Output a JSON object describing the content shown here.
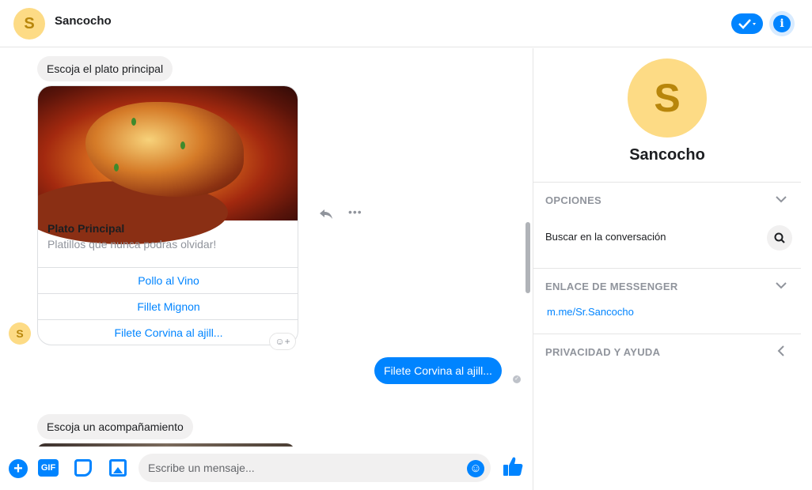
{
  "header": {
    "avatar_letter": "S",
    "title": "Sancocho"
  },
  "chat": {
    "prompt1": "Escoja el plato principal",
    "card": {
      "title": "Plato Principal",
      "subtitle": "Platillos que nunca podras olvidar!",
      "buttons": [
        "Pollo al Vino",
        "Fillet Mignon",
        "Filete Corvina al ajill..."
      ]
    },
    "sender_avatar_letter": "S",
    "outgoing": "Filete Corvina al ajill...",
    "prompt2": "Escoja un acompañamiento"
  },
  "composer": {
    "gif_label": "GIF",
    "placeholder": "Escribe un mensaje..."
  },
  "sidebar": {
    "avatar_letter": "S",
    "name": "Sancocho",
    "options_header": "OPCIONES",
    "search_label": "Buscar en la conversación",
    "link_header": "ENLACE DE MESSENGER",
    "link": "m.me/Sr.Sancocho",
    "privacy_header": "PRIVACIDAD Y AYUDA"
  },
  "colors": {
    "accent": "#0084ff",
    "avatar_bg": "#fddb85",
    "bubble_in": "#f1f0f0"
  }
}
